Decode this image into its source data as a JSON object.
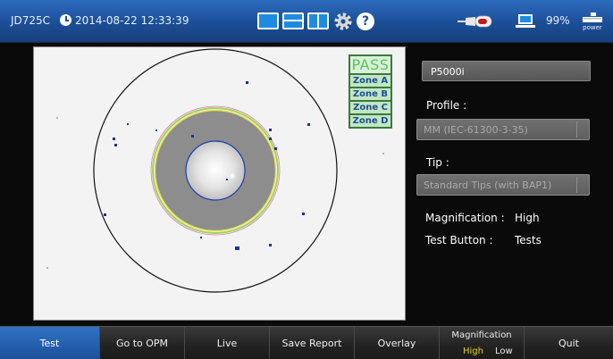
{
  "status_bar": {
    "device": "JD725C",
    "datetime": "2014-08-22  12:33:39",
    "battery": "99%",
    "power_label": "power"
  },
  "inspection": {
    "result": "PASS",
    "zones": [
      "Zone A",
      "Zone B",
      "Zone C",
      "Zone D"
    ]
  },
  "info_panel": {
    "name": "P5000i",
    "profile_label": "Profile :",
    "profile_value": "MM (IEC-61300-3-35)",
    "tip_label": "Tip :",
    "tip_value": "Standard Tips (with BAP1)",
    "magnification_label": "Magnification :",
    "magnification_value": "High",
    "test_button_label": "Test Button :",
    "test_button_value": "Tests"
  },
  "toolbar": {
    "test": "Test",
    "go_to_opm": "Go to OPM",
    "live": "Live",
    "save_report": "Save Report",
    "overlay": "Overlay",
    "magnification_title": "Magnification",
    "magnification_high": "High",
    "magnification_low": "Low",
    "quit": "Quit"
  },
  "colors": {
    "accent": "#1c4f97",
    "pass": "#58c458",
    "selected_option": "#e8d21a"
  }
}
